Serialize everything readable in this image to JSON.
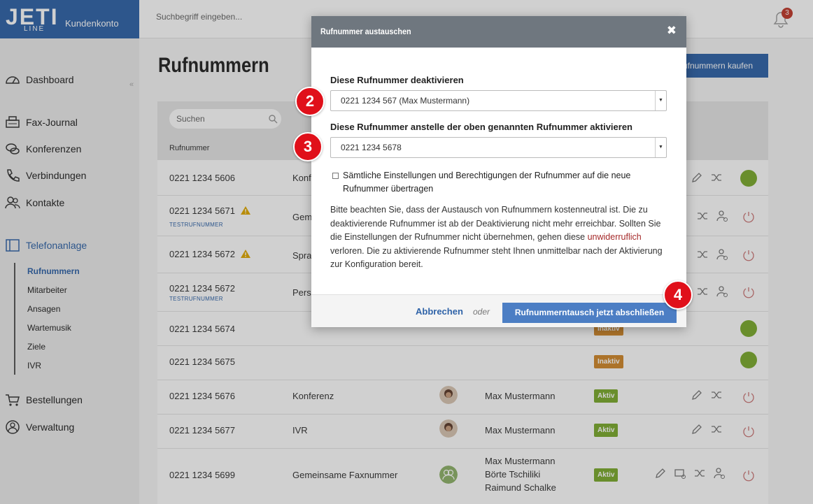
{
  "brand": {
    "logo": "JETI",
    "logo_sub": "LINE",
    "title": "Kundenkonto"
  },
  "topbar": {
    "search_placeholder": "Suchbegriff eingeben...",
    "notification_count": "3"
  },
  "sidebar": {
    "items": [
      {
        "label": "Dashboard",
        "icon": "speedometer-icon"
      },
      {
        "label": "Fax-Journal",
        "icon": "fax-icon"
      },
      {
        "label": "Konferenzen",
        "icon": "conference-icon"
      },
      {
        "label": "Verbindungen",
        "icon": "phone-icon"
      },
      {
        "label": "Kontakte",
        "icon": "contacts-icon"
      },
      {
        "label": "Telefonanlage",
        "icon": "pbx-icon"
      },
      {
        "label": "Bestellungen",
        "icon": "cart-icon"
      },
      {
        "label": "Verwaltung",
        "icon": "user-icon"
      }
    ],
    "subitems": [
      "Rufnummern",
      "Mitarbeiter",
      "Ansagen",
      "Wartemusik",
      "Ziele",
      "IVR"
    ]
  },
  "main": {
    "title": "Rufnummern",
    "buy_button": "Rufnummern kaufen",
    "table_search_placeholder": "Suchen",
    "col_number": "Rufnummer",
    "test_tag": "TESTRUFNUMMER",
    "rows": [
      {
        "number": "0221 1234 5606",
        "type": "Konferenz",
        "status": "",
        "warn": false,
        "test": false
      },
      {
        "number": "0221 1234 5671",
        "type": "Gemeinsame Faxnummer",
        "status": "",
        "warn": true,
        "test": true
      },
      {
        "number": "0221 1234 5672",
        "type": "Sprachbox",
        "status": "",
        "warn": true,
        "test": false
      },
      {
        "number": "0221 1234 5672",
        "type": "Persönlich",
        "status": "",
        "warn": false,
        "test": true
      },
      {
        "number": "0221 1234 5674",
        "type": "",
        "status": "Inaktiv",
        "warn": false,
        "test": false
      },
      {
        "number": "0221 1234 5675",
        "type": "",
        "status": "Inaktiv",
        "warn": false,
        "test": false
      },
      {
        "number": "0221 1234 5676",
        "type": "Konferenz",
        "owner": "Max Mustermann",
        "status": "Aktiv"
      },
      {
        "number": "0221 1234 5677",
        "type": "IVR",
        "owner": "Max Mustermann",
        "status": "Aktiv"
      },
      {
        "number": "0221 1234 5699",
        "type": "Gemeinsame Faxnummer",
        "owners": [
          "Max Mustermann",
          "Börte Tschiliki",
          "Raimund Schalke"
        ],
        "status": "Aktiv"
      }
    ]
  },
  "modal": {
    "title": "Rufnummer austauschen",
    "close": "✖",
    "label_deactivate": "Diese Rufnummer deaktivieren",
    "select_deactivate": "0221 1234 567 (Max Mustermann)",
    "label_activate": "Diese Rufnummer anstelle der oben genannten Rufnummer aktivieren",
    "select_activate": "0221 1234 5678",
    "checkbox_label": "Sämtliche Einstellungen und Berechtigungen der Rufnummer auf die neue Rufnummer übertragen",
    "info_1": "Bitte beachten Sie, dass der Austausch von Rufnummern kostenneutral ist. Die zu deaktivierende Rufnummer ist ab der Deaktivierung nicht mehr erreichbar. Sollten Sie die Einstellungen der Rufnummer nicht übernehmen, gehen diese ",
    "info_red": "unwiderruflich",
    "info_2": " verloren. Die zu aktivierende Rufnummer steht Ihnen unmittelbar nach der Aktivierung zur Konfiguration bereit.",
    "cancel": "Abbrechen",
    "or": "oder",
    "confirm": "Rufnummerntausch jetzt abschließen"
  },
  "steps": [
    "2",
    "3",
    "4"
  ]
}
